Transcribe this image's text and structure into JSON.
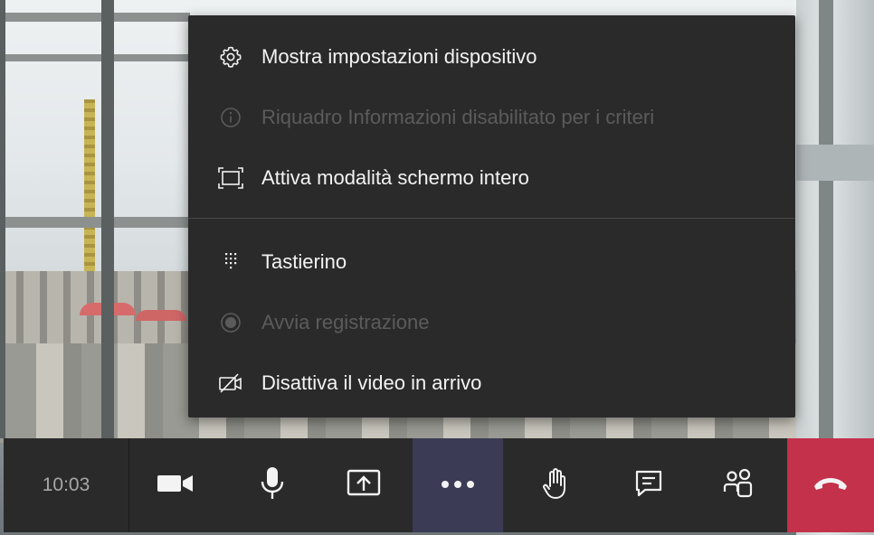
{
  "menu": {
    "items": [
      {
        "label": "Mostra impostazioni dispositivo",
        "icon": "gear-icon",
        "enabled": true
      },
      {
        "label": "Riquadro Informazioni disabilitato per i criteri",
        "icon": "info-icon",
        "enabled": false
      },
      {
        "label": "Attiva modalità schermo intero",
        "icon": "fullscreen-icon",
        "enabled": true
      },
      {
        "label": "Tastierino",
        "icon": "dialpad-icon",
        "enabled": true
      },
      {
        "label": "Avvia registrazione",
        "icon": "record-icon",
        "enabled": false
      },
      {
        "label": "Disattiva il video in arrivo",
        "icon": "video-off-icon",
        "enabled": true
      }
    ]
  },
  "toolbar": {
    "call_time": "10:03",
    "buttons": [
      {
        "name": "camera-button",
        "icon": "video-camera-icon"
      },
      {
        "name": "mic-button",
        "icon": "microphone-icon"
      },
      {
        "name": "share-button",
        "icon": "share-screen-icon"
      },
      {
        "name": "more-actions-button",
        "icon": "more-icon",
        "active": true
      },
      {
        "name": "raise-hand-button",
        "icon": "hand-icon"
      },
      {
        "name": "chat-button",
        "icon": "chat-icon"
      },
      {
        "name": "participants-button",
        "icon": "people-icon"
      },
      {
        "name": "hang-up-button",
        "icon": "phone-hangup-icon"
      }
    ]
  },
  "colors": {
    "menu_bg": "#2b2a2b",
    "text": "#f3f3f3",
    "disabled_text": "#5c5b5c",
    "active_bg": "#3b3b55",
    "hangup": "#c4314b"
  }
}
